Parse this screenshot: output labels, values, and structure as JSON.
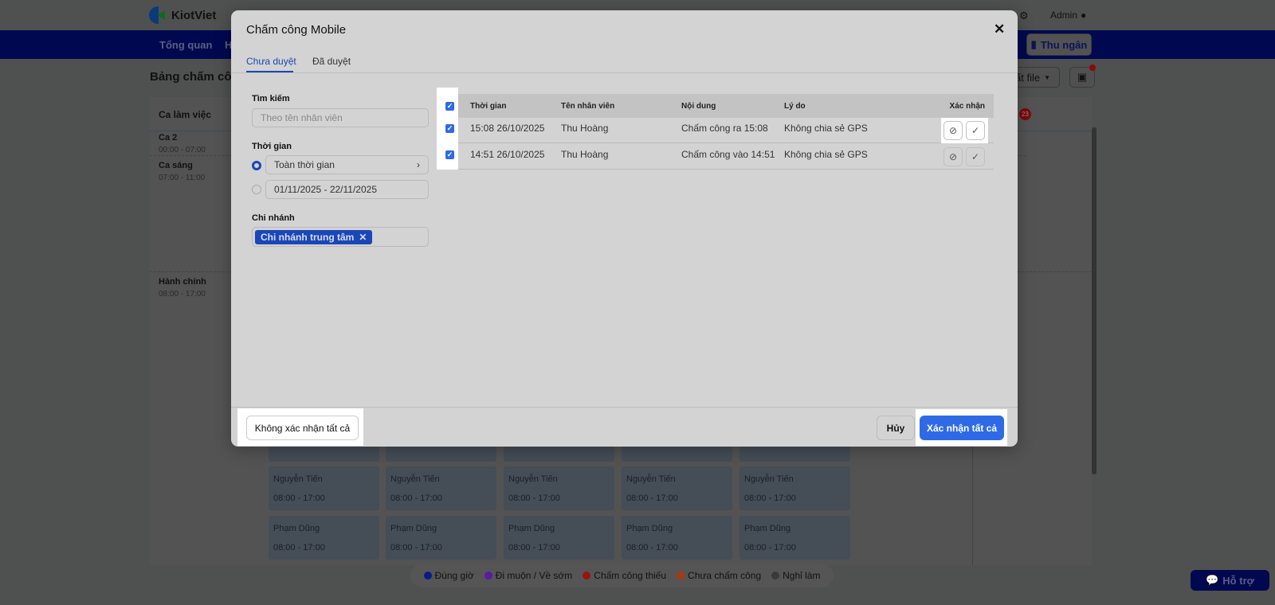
{
  "app": {
    "brand": "KiotViet",
    "user": "Admin",
    "nav": [
      "Tổng quan",
      "H"
    ],
    "cashier": "Thu ngân",
    "page_title": "Bảng chấm côn",
    "export": "ất file",
    "badge": "23",
    "help": "Hỗ trợ"
  },
  "schedule": {
    "header": "Ca làm việc",
    "shifts": [
      {
        "name": "Ca 2",
        "time": "00:00 - 07:00"
      },
      {
        "name": "Ca sáng",
        "time": "07:00 - 11:00"
      },
      {
        "name": "Hành chính",
        "time": "08:00 - 17:00"
      }
    ],
    "cells": [
      {
        "name": "Nguyễn Tiến",
        "time": "08:00 - 17:00"
      },
      {
        "name": "Phạm Dũng",
        "time": "08:00 - 17:00"
      }
    ]
  },
  "legend": [
    {
      "label": "Đúng giờ",
      "color": "#0a1a8a"
    },
    {
      "label": "Đi muộn / Về sớm",
      "color": "#5a1aa0"
    },
    {
      "label": "Chấm công thiếu",
      "color": "#a01010"
    },
    {
      "label": "Chưa chấm công",
      "color": "#a83a10"
    },
    {
      "label": "Nghỉ làm",
      "color": "#3a3a3a"
    }
  ],
  "modal": {
    "title": "Chấm công Mobile",
    "tabs": [
      {
        "label": "Chưa duyệt",
        "active": true
      },
      {
        "label": "Đã duyệt",
        "active": false
      }
    ],
    "filters": {
      "search_label": "Tìm kiếm",
      "search_placeholder": "Theo tên nhân viên",
      "time_label": "Thời gian",
      "time_all": "Toàn thời gian",
      "time_range": "01/11/2025 - 22/11/2025",
      "branch_label": "Chi nhánh",
      "branch_tag": "Chi nhánh trung tâm"
    },
    "columns": [
      "Thời gian",
      "Tên nhân viên",
      "Nội dung",
      "Lý do",
      "Xác nhận"
    ],
    "rows": [
      {
        "checked": true,
        "time": "15:08 26/10/2025",
        "employee": "Thu Hoàng",
        "content": "Chấm công ra 15:08",
        "reason": "Không chia sẻ GPS"
      },
      {
        "checked": true,
        "time": "14:51 26/10/2025",
        "employee": "Thu Hoàng",
        "content": "Chấm công vào 14:51",
        "reason": "Không chia sẻ GPS"
      }
    ],
    "footer": {
      "reject_all": "Không xác nhận tất cả",
      "cancel": "Hủy",
      "confirm_all": "Xác nhận tất cả"
    },
    "accent": "#2f6ae6"
  }
}
